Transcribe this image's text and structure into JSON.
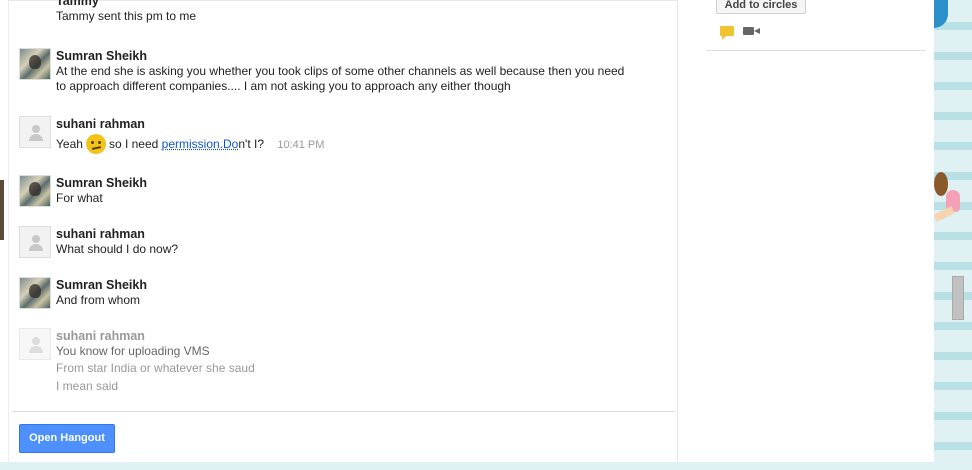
{
  "chat": {
    "messages": [
      {
        "sender": "Tammy",
        "lines": [
          "Tammy sent this pm to me"
        ]
      },
      {
        "sender": "Sumran Sheikh",
        "lines": [
          "At the end she is asking you whether you took clips of some other channels as well because then you need",
          "to approach different companies.... I am not asking you to approach any either though"
        ]
      },
      {
        "sender": "suhani rahman",
        "before_emoji": "Yeah",
        "after_emoji": "so I need",
        "link_text": "permission.Do",
        "after_link": "n't I?",
        "time": "10:41 PM"
      },
      {
        "sender": "Sumran Sheikh",
        "lines": [
          "For what"
        ]
      },
      {
        "sender": "suhani rahman",
        "lines": [
          "What should I do now?"
        ]
      },
      {
        "sender": "Sumran Sheikh",
        "lines": [
          "And from whom"
        ]
      },
      {
        "sender": "suhani rahman",
        "lines": [
          "You know for uploading VMS",
          "From star India or whatever she saud",
          "I mean said"
        ]
      }
    ],
    "open_hangout_label": "Open Hangout"
  },
  "sidebar": {
    "add_to_circles_label": "Add to circles",
    "icons": [
      "chat-icon",
      "video-camera-icon"
    ]
  },
  "colors": {
    "primary_button": "#4d90fe",
    "link": "#1155cc",
    "emoji": "#f2c319"
  }
}
